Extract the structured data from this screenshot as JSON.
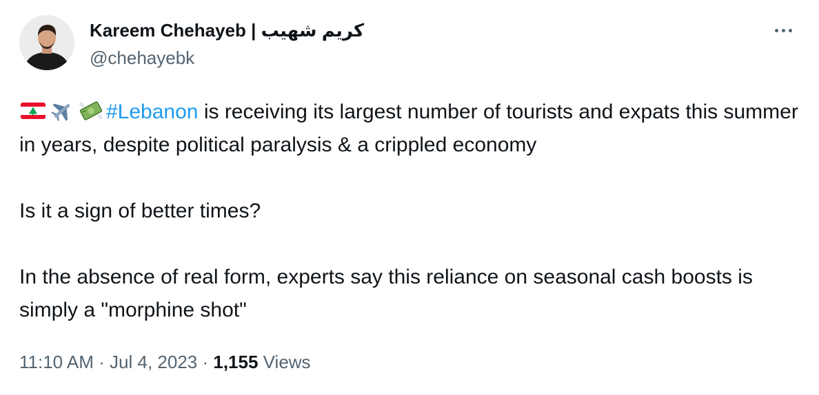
{
  "author": {
    "display_name": "Kareem Chehayeb | كريم شهيب",
    "handle": "@chehayebk"
  },
  "tweet": {
    "line1_emojis": [
      "lebanon-flag-icon",
      "airplane-icon",
      "money-with-wings-icon"
    ],
    "hashtag": "#Lebanon",
    "paragraph1_rest": " is receiving its largest number of tourists and expats this summer in years, despite political paralysis & a crippled economy",
    "paragraph2": "Is it a sign of better times?",
    "paragraph3": "In the absence of real form, experts say this reliance on seasonal cash boosts is simply a \"morphine shot\""
  },
  "meta": {
    "time": "11:10 AM",
    "separator": " · ",
    "date": "Jul 4, 2023",
    "views_count": "1,155",
    "views_label": " Views"
  },
  "colors": {
    "text": "#0f1419",
    "secondary": "#536471",
    "link": "#1d9bf0"
  }
}
